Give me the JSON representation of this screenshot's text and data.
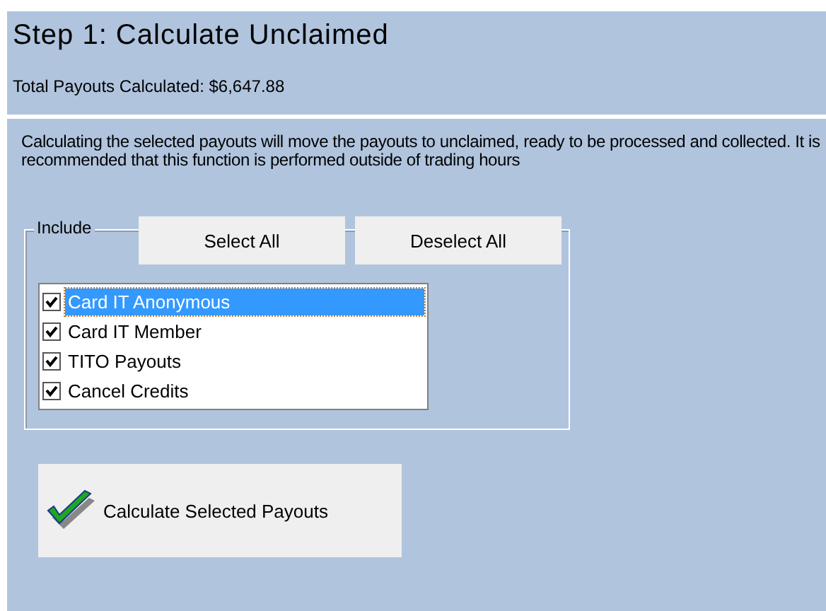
{
  "header": {
    "title": "Step 1: Calculate Unclaimed",
    "total": "Total Payouts Calculated: $6,647.88"
  },
  "description": "Calculating the selected payouts will move the payouts to unclaimed, ready to be processed and collected. It is recommended that this function is performed outside of trading hours",
  "include": {
    "legend": "Include",
    "buttons": [
      "Select All",
      "Deselect All"
    ],
    "items": [
      {
        "label": "Card IT Anonymous",
        "checked": true,
        "selected": true
      },
      {
        "label": "Card IT Member",
        "checked": true,
        "selected": false
      },
      {
        "label": "TITO Payouts",
        "checked": true,
        "selected": false
      },
      {
        "label": "Cancel Credits",
        "checked": true,
        "selected": false
      }
    ]
  },
  "action_button": "Calculate Selected Payouts"
}
